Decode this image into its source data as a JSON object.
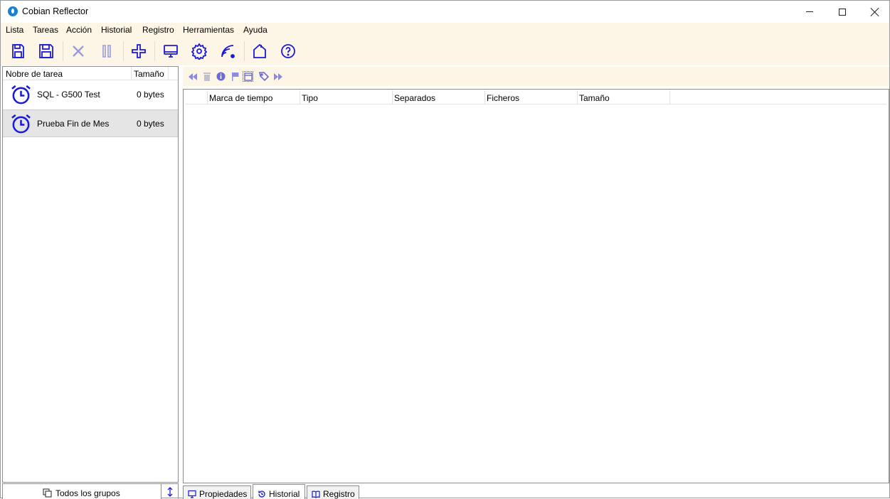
{
  "window": {
    "title": "Cobian Reflector"
  },
  "menu": [
    "Lista",
    "Tareas",
    "Acción",
    "Historial",
    "Registro",
    "Herramientas",
    "Ayuda"
  ],
  "toolbar_icons": [
    "open-list-icon",
    "save-list-icon",
    "stop-icon",
    "pause-icon",
    "add-task-icon",
    "monitor-icon",
    "settings-icon",
    "network-icon",
    "home-icon",
    "help-icon"
  ],
  "task_list": {
    "columns": [
      "Nobre de tarea",
      "Tamaño"
    ],
    "rows": [
      {
        "name": "SQL - G500 Test",
        "size": "0 bytes",
        "selected": false
      },
      {
        "name": "Prueba Fin de Mes",
        "size": "0 bytes",
        "selected": true
      }
    ]
  },
  "history_toolbar_icons": [
    "first-icon",
    "delete-icon",
    "info-icon",
    "flag-icon",
    "select-all-icon",
    "tag-icon",
    "last-icon"
  ],
  "history_table": {
    "columns": [
      "Marca de tiempo",
      "Tipo",
      "Separados",
      "Ficheros",
      "Tamaño"
    ],
    "rows": []
  },
  "groups": {
    "label": "Todos los grupos"
  },
  "tabs": [
    {
      "label": "Propiedades",
      "active": false
    },
    {
      "label": "Historial",
      "active": true
    },
    {
      "label": "Registro",
      "active": false
    }
  ],
  "colors": {
    "accent": "#1a1adb",
    "toolbar_bg": "#fdf5e6",
    "selection_bg": "#e5e5e5"
  }
}
